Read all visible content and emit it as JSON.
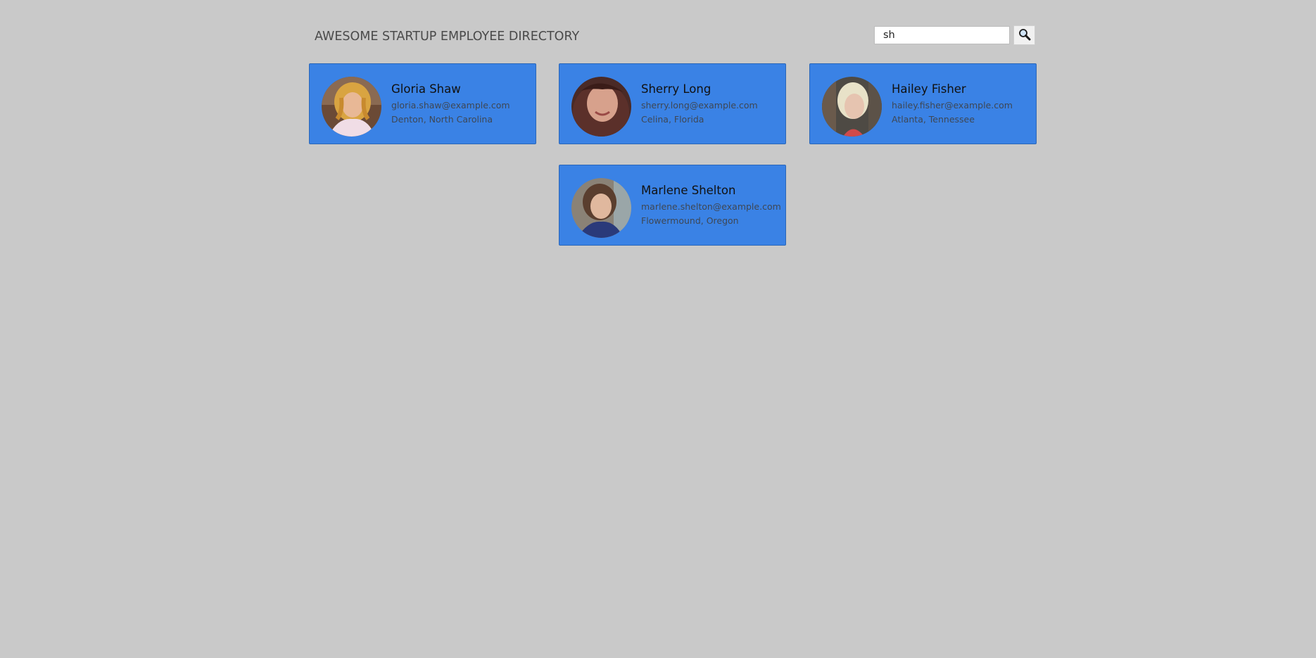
{
  "header": {
    "title": "AWESOME STARTUP EMPLOYEE DIRECTORY"
  },
  "search": {
    "value": "sh",
    "button_icon": "search-icon"
  },
  "colors": {
    "background": "#c9c9c9",
    "card": "#3a82e5"
  },
  "employees": [
    {
      "name": "Gloria Shaw",
      "email": "gloria.shaw@example.com",
      "location": "Denton, North Carolina"
    },
    {
      "name": "Sherry Long",
      "email": "sherry.long@example.com",
      "location": "Celina, Florida"
    },
    {
      "name": "Hailey Fisher",
      "email": "hailey.fisher@example.com",
      "location": "Atlanta, Tennessee"
    },
    {
      "name": "Marlene Shelton",
      "email": "marlene.shelton@example.com",
      "location": "Flowermound, Oregon"
    }
  ]
}
